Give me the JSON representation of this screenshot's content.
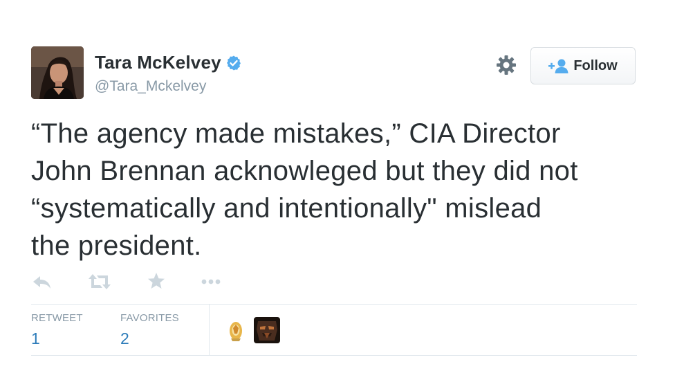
{
  "author": {
    "display_name": "Tara McKelvey",
    "screen_name": "@Tara_Mckelvey",
    "verified": true,
    "avatar_icon": "user-avatar-photo"
  },
  "header": {
    "settings_icon": "gear-icon",
    "follow_button": {
      "label": "Follow",
      "icon": "add-person-icon"
    }
  },
  "tweet": {
    "lines": [
      "“The agency made mistakes,” CIA Director",
      "John Brennan acknowleged but they did not",
      "“systematically and intentionally\" mislead",
      "the president."
    ]
  },
  "actions": [
    {
      "name": "reply",
      "icon": "reply-icon"
    },
    {
      "name": "retweet",
      "icon": "retweet-icon"
    },
    {
      "name": "favorite",
      "icon": "star-icon"
    },
    {
      "name": "more",
      "icon": "more-icon"
    }
  ],
  "stats": {
    "retweets": {
      "label": "RETWEET",
      "value": "1"
    },
    "favorites": {
      "label": "FAVORITES",
      "value": "2"
    }
  },
  "favorited_by": [
    "favoriter-avatar-1",
    "favoriter-avatar-2"
  ],
  "colors": {
    "verified_badge": "#55acee",
    "link_blue": "#2b7bb9",
    "muted_gray": "#8899a6",
    "icon_gray": "#ccd6dd",
    "text": "#292f33"
  }
}
